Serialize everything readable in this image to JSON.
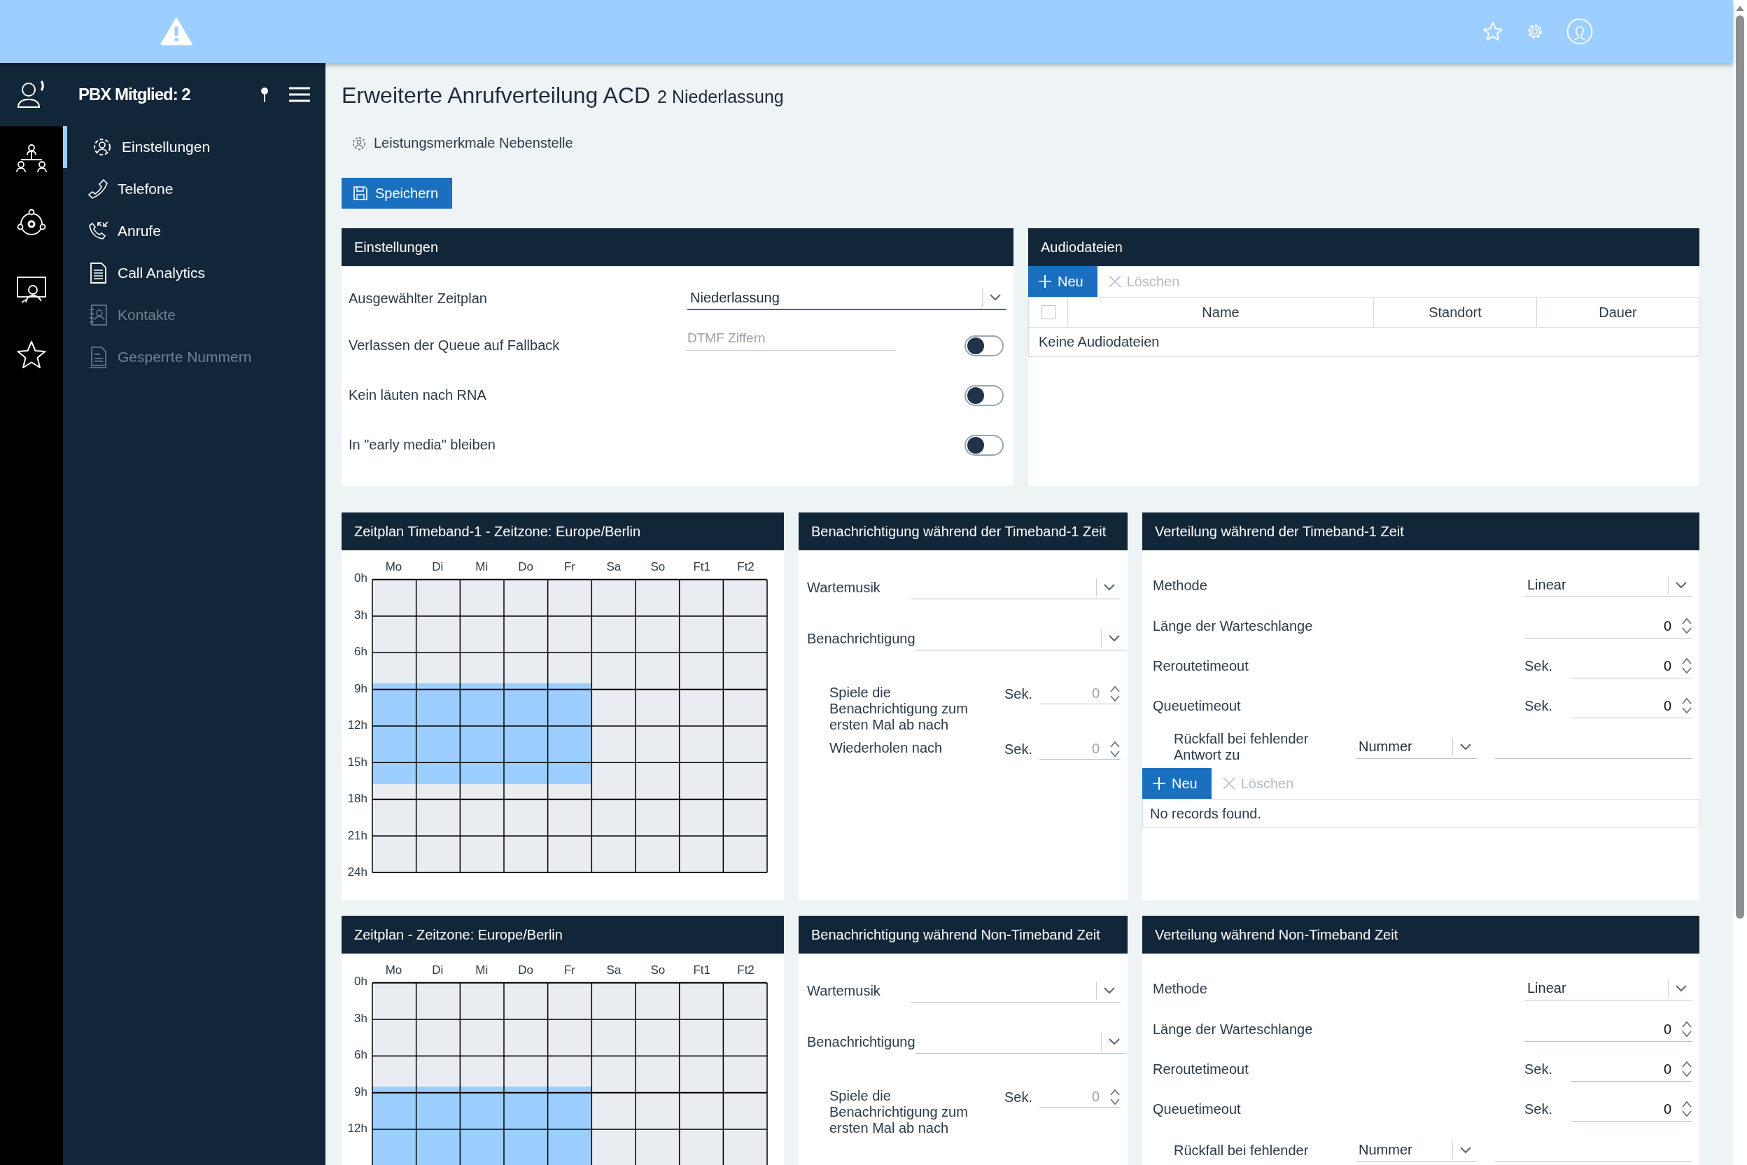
{
  "sidebar": {
    "title": "PBX Mitglied: 2",
    "items": [
      {
        "label": "Einstellungen",
        "selected": true,
        "disabled": false
      },
      {
        "label": "Telefone",
        "selected": false,
        "disabled": false
      },
      {
        "label": "Anrufe",
        "selected": false,
        "disabled": false
      },
      {
        "label": "Call Analytics",
        "selected": false,
        "disabled": false
      },
      {
        "label": "Kontakte",
        "selected": false,
        "disabled": true
      },
      {
        "label": "Gesperrte Nummern",
        "selected": false,
        "disabled": true
      }
    ]
  },
  "page": {
    "title": "Erweiterte Anrufverteilung ACD",
    "subtitle": "2 Niederlassung",
    "feature_link": "Leistungsmerkmale Nebenstelle",
    "save_button": "Speichern"
  },
  "settings": {
    "title": "Einstellungen",
    "rows": [
      {
        "kind": "select",
        "label": "Ausgewählter Zeitplan",
        "value": "Niederlassung",
        "focused": true
      },
      {
        "kind": "toggle",
        "label": "Verlassen der Queue auf Fallback",
        "placeholder": "DTMF Ziffern",
        "on": false
      },
      {
        "kind": "toggle",
        "label": "Kein läuten nach RNA",
        "on": false
      },
      {
        "kind": "toggle",
        "label": "In \"early media\" bleiben",
        "on": false
      }
    ]
  },
  "audio": {
    "title": "Audiodateien",
    "new_button": "Neu",
    "delete_button": {
      "label": "Löschen",
      "disabled": true
    },
    "select_all": {
      "checked": false
    },
    "columns": [
      "Name",
      "Standort",
      "Dauer"
    ],
    "empty": "Keine Audiodateien"
  },
  "sections": [
    {
      "schedule": {
        "title": "Zeitplan Timeband-1 - Zeitzone: Europe/Berlin",
        "days": [
          {
            "label": "Mo",
            "active": true
          },
          {
            "label": "Di",
            "active": true
          },
          {
            "label": "Mi",
            "active": true
          },
          {
            "label": "Do",
            "active": true
          },
          {
            "label": "Fr",
            "active": true
          },
          {
            "label": "Sa",
            "active": false
          },
          {
            "label": "So",
            "active": false
          },
          {
            "label": "Ft1",
            "active": false
          },
          {
            "label": "Ft2",
            "active": false
          }
        ],
        "hours": [
          "0h",
          "3h",
          "6h",
          "9h",
          "12h",
          "15h",
          "18h",
          "21h",
          "24h"
        ]
      },
      "notification": {
        "title": "Benachrichtigung während der Timeband-1 Zeit",
        "selects": [
          {
            "label": "Wartemusik"
          },
          {
            "label": "Benachrichtigung"
          }
        ],
        "timers": [
          {
            "label": "Spiele die Benachrichtigung zum ersten Mal ab nach",
            "unit": "Sek.",
            "value": "0",
            "disabled": true
          },
          {
            "label": "Wiederholen nach",
            "unit": "Sek.",
            "value": "0",
            "disabled": true
          }
        ]
      },
      "distribution": {
        "title": "Verteilung während der Timeband-1 Zeit",
        "method": {
          "label": "Methode",
          "value": "Linear"
        },
        "numbers": [
          {
            "label": "Länge der Warteschlange",
            "value": "0"
          },
          {
            "label": "Reroutetimeout",
            "unit": "Sek.",
            "value": "0"
          },
          {
            "label": "Queuetimeout",
            "unit": "Sek.",
            "value": "0"
          }
        ],
        "fallback": {
          "label": "Rückfall bei fehlender Antwort zu",
          "value": "Nummer"
        },
        "new_button": "Neu",
        "delete_button": {
          "label": "Löschen",
          "disabled": true
        },
        "empty": "No records found."
      }
    },
    {
      "schedule": {
        "title": "Zeitplan - Zeitzone: Europe/Berlin",
        "days": [
          {
            "label": "Mo",
            "active": true
          },
          {
            "label": "Di",
            "active": true
          },
          {
            "label": "Mi",
            "active": true
          },
          {
            "label": "Do",
            "active": true
          },
          {
            "label": "Fr",
            "active": true
          },
          {
            "label": "Sa",
            "active": false
          },
          {
            "label": "So",
            "active": false
          },
          {
            "label": "Ft1",
            "active": false
          },
          {
            "label": "Ft2",
            "active": false
          }
        ],
        "hours": [
          "0h",
          "3h",
          "6h",
          "9h",
          "12h"
        ]
      },
      "notification": {
        "title": "Benachrichtigung während Non-Timeband Zeit",
        "selects": [
          {
            "label": "Wartemusik"
          },
          {
            "label": "Benachrichtigung"
          }
        ],
        "timers": [
          {
            "label": "Spiele die Benachrichtigung zum ersten Mal ab nach",
            "unit": "Sek.",
            "value": "0",
            "disabled": true
          }
        ]
      },
      "distribution": {
        "title": "Verteilung während Non-Timeband Zeit",
        "method": {
          "label": "Methode",
          "value": "Linear"
        },
        "numbers": [
          {
            "label": "Länge der Warteschlange",
            "value": "0"
          },
          {
            "label": "Reroutetimeout",
            "unit": "Sek.",
            "value": "0"
          },
          {
            "label": "Queuetimeout",
            "unit": "Sek.",
            "value": "0"
          }
        ],
        "fallback": {
          "label": "Rückfall bei fehlender",
          "value": "Nummer"
        }
      }
    }
  ]
}
